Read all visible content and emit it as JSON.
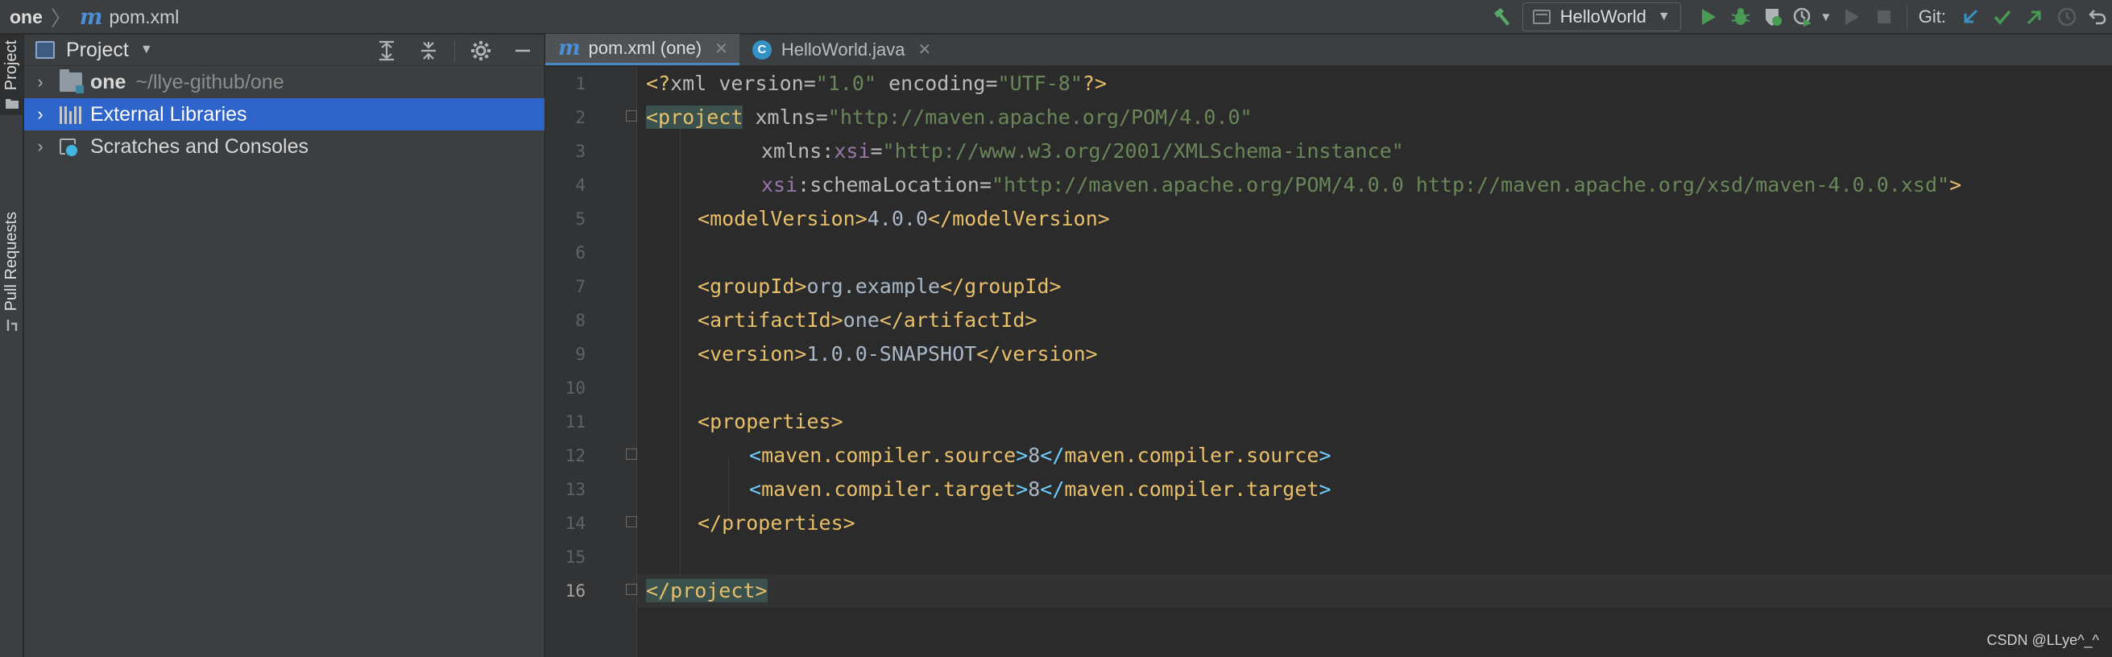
{
  "breadcrumb": {
    "project": "one",
    "file": "pom.xml"
  },
  "toolbar": {
    "run_config": "HelloWorld",
    "git_label": "Git:"
  },
  "stripe": {
    "project": "Project",
    "pull_requests": "Pull Requests"
  },
  "project_panel": {
    "title": "Project",
    "tree": [
      {
        "name": "one",
        "path": "~/llye-github/one",
        "icon": "folder-icon"
      },
      {
        "name": "External Libraries",
        "icon": "library-icon",
        "selected": true
      },
      {
        "name": "Scratches and Consoles",
        "icon": "scratches-icon"
      }
    ]
  },
  "tabs": [
    {
      "label": "pom.xml (one)",
      "icon": "maven-icon",
      "active": true
    },
    {
      "label": "HelloWorld.java",
      "icon": "java-class-icon",
      "active": false
    }
  ],
  "editor": {
    "current_line": 16,
    "line_numbers": [
      "1",
      "2",
      "3",
      "4",
      "5",
      "6",
      "7",
      "8",
      "9",
      "10",
      "11",
      "12",
      "13",
      "14",
      "15",
      "16"
    ],
    "code": {
      "l1": [
        "<?",
        "xml version",
        "=",
        "\"1.0\"",
        " encoding",
        "=",
        "\"UTF-8\"",
        "?>"
      ],
      "l2": [
        "<project",
        " xmlns",
        "=",
        "\"http://maven.apache.org/POM/4.0.0\""
      ],
      "l3": [
        "xmlns:",
        "xsi",
        "=",
        "\"http://www.w3.org/2001/XMLSchema-instance\""
      ],
      "l4": [
        "xsi",
        ":schemaLocation",
        "=",
        "\"http://maven.apache.org/POM/4.0.0 http://maven.apache.org/xsd/maven-4.0.0.xsd\"",
        ">"
      ],
      "l5": [
        "<",
        "modelVersion",
        ">",
        "4.0.0",
        "</",
        "modelVersion",
        ">"
      ],
      "l7": [
        "<",
        "groupId",
        ">",
        "org.example",
        "</",
        "groupId",
        ">"
      ],
      "l8": [
        "<",
        "artifactId",
        ">",
        "one",
        "</",
        "artifactId",
        ">"
      ],
      "l9": [
        "<",
        "version",
        ">",
        "1.0.0-SNAPSHOT",
        "</",
        "version",
        ">"
      ],
      "l11": [
        "<",
        "properties",
        ">"
      ],
      "l12": [
        "<",
        "maven.compiler.source",
        ">",
        "8",
        "</",
        "maven.compiler.source",
        ">"
      ],
      "l13": [
        "<",
        "maven.compiler.target",
        ">",
        "8",
        "</",
        "maven.compiler.target",
        ">"
      ],
      "l14": [
        "</",
        "properties",
        ">"
      ],
      "l16": [
        "</project>"
      ]
    }
  },
  "watermark": "CSDN @LLye^_^",
  "colors": {
    "bg": "#2b2b2b",
    "panel": "#3c3f41",
    "selection": "#2f65ca",
    "tag": "#e8bf6a",
    "string": "#6a8759",
    "namespace": "#9876aa",
    "bracket": "#6fd0ff"
  }
}
